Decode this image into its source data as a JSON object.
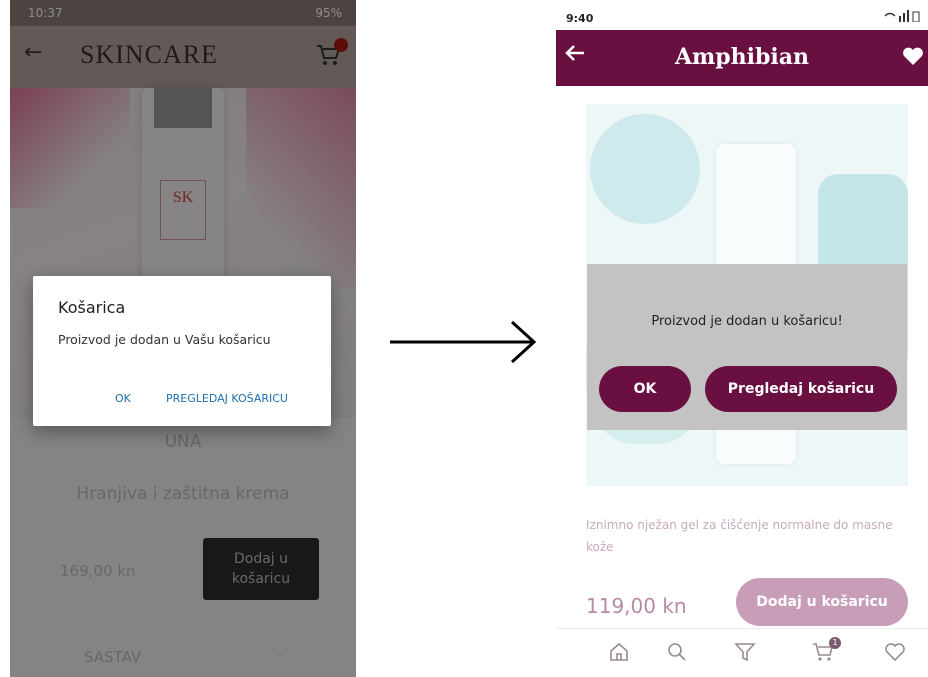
{
  "left": {
    "status_time": "10:37",
    "status_battery": "95%",
    "app_title": "SKINCARE",
    "bottle_label": "SK",
    "product_brand": "UNA",
    "product_name": "Hranjiva i zaštitna krema",
    "price": "169,00 kn",
    "add_to_cart_label": "Dodaj u košaricu",
    "section_label": "SASTAV",
    "dialog": {
      "title": "Košarica",
      "message": "Proizvod je dodan u Vašu košaricu",
      "ok_label": "OK",
      "view_cart_label": "PREGLEDAJ KOŠARICU"
    }
  },
  "right": {
    "status_time": "9:40",
    "app_title": "Amphibian",
    "dialog": {
      "message": "Proizvod je dodan u košaricu!",
      "ok_label": "OK",
      "view_cart_label": "Pregledaj košaricu"
    },
    "description": "Iznimno nježan gel za čišćenje normalne do masne kože",
    "price": "119,00 kn",
    "add_to_cart_label": "Dodaj u košaricu",
    "cart_badge": "1",
    "nav_items": [
      "home-icon",
      "search-icon",
      "filter-icon",
      "cart-icon",
      "favorites-icon"
    ]
  },
  "colors": {
    "left_accent": "#1f6fae",
    "right_brand": "#6a1040",
    "right_brand_light": "#c79db8"
  }
}
